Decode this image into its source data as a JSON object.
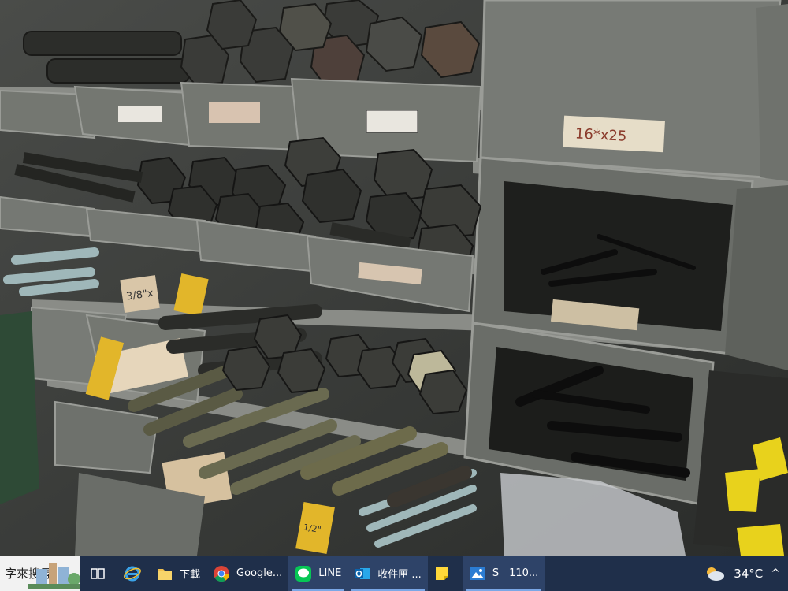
{
  "taskbar": {
    "search_text": "字來搜尋",
    "apps": [
      {
        "label": "下載",
        "icon": "folder-icon"
      },
      {
        "label": "Google...",
        "icon": "chrome-icon"
      },
      {
        "label": "LINE",
        "icon": "line-icon"
      },
      {
        "label": "收件匣 ...",
        "icon": "outlook-icon"
      },
      {
        "label": "",
        "icon": "sticky-notes-icon"
      },
      {
        "label": "S__110...",
        "icon": "photos-icon"
      }
    ],
    "weather": {
      "temperature": "34°C",
      "icon": "cloudy-weather-icon"
    },
    "tray_chevron": "^"
  },
  "photo": {
    "bin_labels": [
      "16*x25",
      "3/8\"x",
      "1/2\""
    ]
  },
  "colors": {
    "taskbar_bg": "#1f2f4a",
    "active_app_bg": "#2e4368",
    "bin_gray": "#6e716d"
  }
}
